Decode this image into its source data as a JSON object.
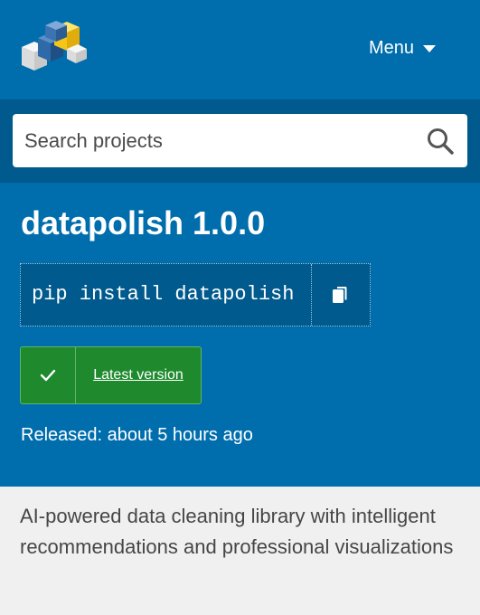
{
  "header": {
    "logo_icon": "pypi-logo-icon",
    "menu_label": "Menu",
    "menu_icon": "caret-down-icon"
  },
  "search": {
    "placeholder": "Search projects",
    "value": "",
    "icon": "search-icon"
  },
  "package": {
    "title": "datapolish 1.0.0",
    "install_command": "pip install datapolish",
    "copy_icon": "copy-icon",
    "latest_label": "Latest version",
    "latest_icon": "checkmark-icon",
    "released": "Released: about 5 hours ago"
  },
  "summary": {
    "text": "AI-powered data cleaning library with intelligent recommendations and professional visualizations"
  },
  "colors": {
    "header_blue": "#006dad",
    "search_band": "#005a8d",
    "badge_green": "#1e8a2d",
    "summary_bg": "#f0f0f0"
  }
}
